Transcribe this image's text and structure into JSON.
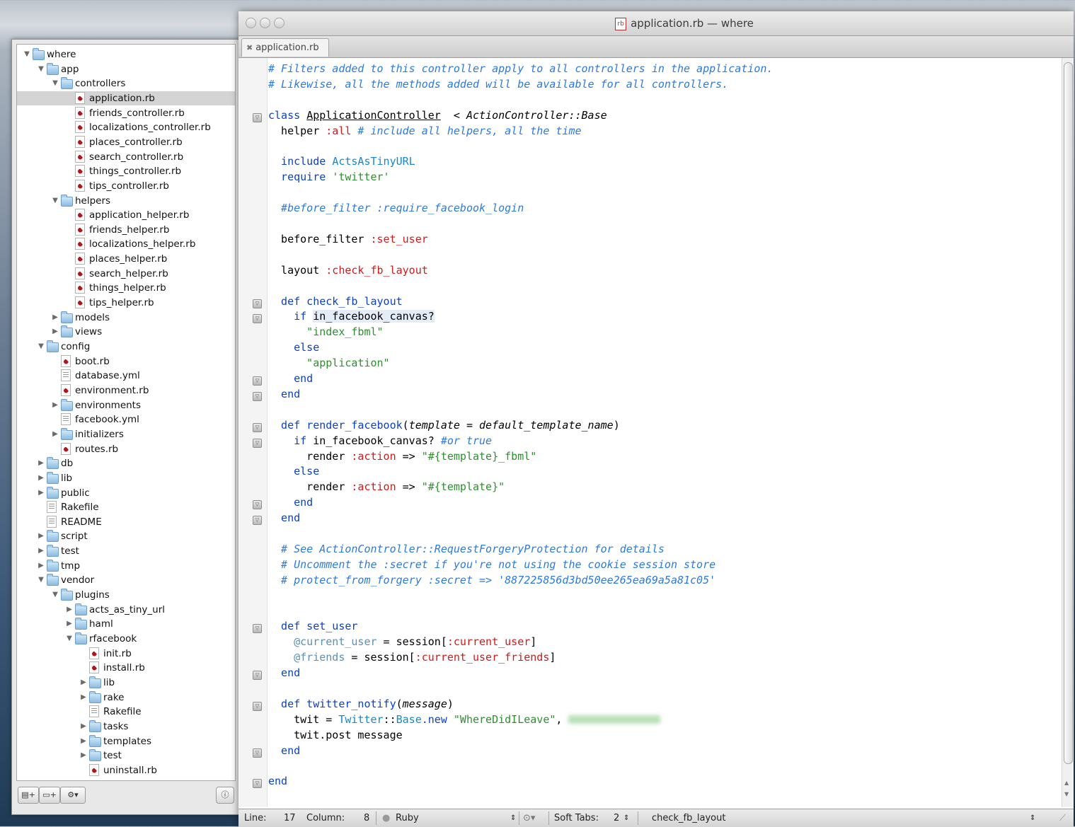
{
  "window": {
    "title": "application.rb — where",
    "doc_icon": "rb",
    "tab_label": "application.rb"
  },
  "tree": [
    {
      "depth": 0,
      "type": "folder",
      "open": true,
      "label": "where"
    },
    {
      "depth": 1,
      "type": "folder",
      "open": true,
      "label": "app"
    },
    {
      "depth": 2,
      "type": "folder",
      "open": true,
      "label": "controllers"
    },
    {
      "depth": 3,
      "type": "rb",
      "label": "application.rb",
      "selected": true
    },
    {
      "depth": 3,
      "type": "rb",
      "label": "friends_controller.rb"
    },
    {
      "depth": 3,
      "type": "rb",
      "label": "localizations_controller.rb"
    },
    {
      "depth": 3,
      "type": "rb",
      "label": "places_controller.rb"
    },
    {
      "depth": 3,
      "type": "rb",
      "label": "search_controller.rb"
    },
    {
      "depth": 3,
      "type": "rb",
      "label": "things_controller.rb"
    },
    {
      "depth": 3,
      "type": "rb",
      "label": "tips_controller.rb"
    },
    {
      "depth": 2,
      "type": "folder",
      "open": true,
      "label": "helpers"
    },
    {
      "depth": 3,
      "type": "rb",
      "label": "application_helper.rb"
    },
    {
      "depth": 3,
      "type": "rb",
      "label": "friends_helper.rb"
    },
    {
      "depth": 3,
      "type": "rb",
      "label": "localizations_helper.rb"
    },
    {
      "depth": 3,
      "type": "rb",
      "label": "places_helper.rb"
    },
    {
      "depth": 3,
      "type": "rb",
      "label": "search_helper.rb"
    },
    {
      "depth": 3,
      "type": "rb",
      "label": "things_helper.rb"
    },
    {
      "depth": 3,
      "type": "rb",
      "label": "tips_helper.rb"
    },
    {
      "depth": 2,
      "type": "folder",
      "open": false,
      "label": "models"
    },
    {
      "depth": 2,
      "type": "folder",
      "open": false,
      "label": "views"
    },
    {
      "depth": 1,
      "type": "folder",
      "open": true,
      "label": "config"
    },
    {
      "depth": 2,
      "type": "rb",
      "label": "boot.rb"
    },
    {
      "depth": 2,
      "type": "txt",
      "label": "database.yml"
    },
    {
      "depth": 2,
      "type": "rb",
      "label": "environment.rb"
    },
    {
      "depth": 2,
      "type": "folder",
      "open": false,
      "label": "environments"
    },
    {
      "depth": 2,
      "type": "txt",
      "label": "facebook.yml"
    },
    {
      "depth": 2,
      "type": "folder",
      "open": false,
      "label": "initializers"
    },
    {
      "depth": 2,
      "type": "rb",
      "label": "routes.rb"
    },
    {
      "depth": 1,
      "type": "folder",
      "open": false,
      "label": "db"
    },
    {
      "depth": 1,
      "type": "folder",
      "open": false,
      "label": "lib"
    },
    {
      "depth": 1,
      "type": "folder",
      "open": false,
      "label": "public"
    },
    {
      "depth": 1,
      "type": "txt",
      "label": "Rakefile"
    },
    {
      "depth": 1,
      "type": "txt",
      "label": "README"
    },
    {
      "depth": 1,
      "type": "folder",
      "open": false,
      "label": "script"
    },
    {
      "depth": 1,
      "type": "folder",
      "open": false,
      "label": "test"
    },
    {
      "depth": 1,
      "type": "folder",
      "open": false,
      "label": "tmp"
    },
    {
      "depth": 1,
      "type": "folder",
      "open": true,
      "label": "vendor"
    },
    {
      "depth": 2,
      "type": "folder",
      "open": true,
      "label": "plugins"
    },
    {
      "depth": 3,
      "type": "folder",
      "open": false,
      "label": "acts_as_tiny_url"
    },
    {
      "depth": 3,
      "type": "folder",
      "open": false,
      "label": "haml"
    },
    {
      "depth": 3,
      "type": "folder",
      "open": true,
      "label": "rfacebook"
    },
    {
      "depth": 4,
      "type": "rb",
      "label": "init.rb"
    },
    {
      "depth": 4,
      "type": "rb",
      "label": "install.rb"
    },
    {
      "depth": 4,
      "type": "folder",
      "open": false,
      "label": "lib"
    },
    {
      "depth": 4,
      "type": "folder",
      "open": false,
      "label": "rake"
    },
    {
      "depth": 4,
      "type": "txt",
      "label": "Rakefile"
    },
    {
      "depth": 4,
      "type": "folder",
      "open": false,
      "label": "tasks"
    },
    {
      "depth": 4,
      "type": "folder",
      "open": false,
      "label": "templates"
    },
    {
      "depth": 4,
      "type": "folder",
      "open": false,
      "label": "test"
    },
    {
      "depth": 4,
      "type": "rb",
      "label": "uninstall.rb"
    }
  ],
  "drawer_buttons": {
    "new_file_icon": "new-file-icon",
    "new_folder_icon": "new-folder-icon",
    "action_icon": "gear-icon",
    "info_icon": "info-icon"
  },
  "code_lines": [
    [
      [
        "cm",
        "# Filters added to this controller apply to all controllers in the application."
      ]
    ],
    [
      [
        "cm",
        "# Likewise, all the methods added will be available for all controllers."
      ]
    ],
    [],
    [
      [
        "kw",
        "class "
      ],
      [
        "ul",
        "ApplicationController"
      ],
      [
        "",
        "  < "
      ],
      [
        "it",
        "ActionController::Base"
      ]
    ],
    [
      [
        "",
        "  helper "
      ],
      [
        "sym",
        ":all"
      ],
      [
        "cm",
        " # include all helpers, all the time"
      ]
    ],
    [],
    [
      [
        "kw",
        "  include "
      ],
      [
        "cls",
        "ActsAsTinyURL"
      ]
    ],
    [
      [
        "kw",
        "  require "
      ],
      [
        "str",
        "'twitter'"
      ]
    ],
    [],
    [
      [
        "cm",
        "  #before_filter :require_facebook_login"
      ]
    ],
    [],
    [
      [
        "",
        "  before_filter "
      ],
      [
        "sym",
        ":set_user"
      ]
    ],
    [],
    [
      [
        "",
        "  layout "
      ],
      [
        "sym",
        ":check_fb_layout"
      ]
    ],
    [],
    [
      [
        "kw",
        "  def check_fb_layout"
      ]
    ],
    [
      [
        "kw",
        "    if "
      ],
      [
        "hl",
        "in_facebook_canvas?"
      ]
    ],
    [
      [
        "str",
        "      \"index_fbml\""
      ]
    ],
    [
      [
        "kw",
        "    else"
      ]
    ],
    [
      [
        "str",
        "      \"application\""
      ]
    ],
    [
      [
        "kw",
        "    end"
      ]
    ],
    [
      [
        "kw",
        "  end"
      ]
    ],
    [],
    [
      [
        "kw",
        "  def render_facebook"
      ],
      [
        "",
        "("
      ],
      [
        "it",
        "template"
      ],
      [
        "",
        " = "
      ],
      [
        "it",
        "default_template_name"
      ],
      [
        "",
        ")"
      ]
    ],
    [
      [
        "kw",
        "    if "
      ],
      [
        "",
        "in_facebook_canvas? "
      ],
      [
        "cm",
        "#or true"
      ]
    ],
    [
      [
        "",
        "      render "
      ],
      [
        "sym",
        ":action"
      ],
      [
        "",
        " => "
      ],
      [
        "str",
        "\"#{template}_fbml\""
      ]
    ],
    [
      [
        "kw",
        "    else"
      ]
    ],
    [
      [
        "",
        "      render "
      ],
      [
        "sym",
        ":action"
      ],
      [
        "",
        " => "
      ],
      [
        "str",
        "\"#{template}\""
      ]
    ],
    [
      [
        "kw",
        "    end"
      ]
    ],
    [
      [
        "kw",
        "  end"
      ]
    ],
    [],
    [
      [
        "cm",
        "  # See ActionController::RequestForgeryProtection for details"
      ]
    ],
    [
      [
        "cm",
        "  # Uncomment the :secret if you're not using the cookie session store"
      ]
    ],
    [
      [
        "cm",
        "  # protect_from_forgery :secret => '887225856d3bd50ee265ea69a5a81c05'"
      ]
    ],
    [],
    [],
    [
      [
        "kw",
        "  def set_user"
      ]
    ],
    [
      [
        "var",
        "    @current_user"
      ],
      [
        "",
        " = session["
      ],
      [
        "sym",
        ":current_user"
      ],
      [
        "",
        "]"
      ]
    ],
    [
      [
        "var",
        "    @friends"
      ],
      [
        "",
        " = session["
      ],
      [
        "sym",
        ":current_user_friends"
      ],
      [
        "",
        "]"
      ]
    ],
    [
      [
        "kw",
        "  end"
      ]
    ],
    [],
    [
      [
        "kw",
        "  def twitter_notify"
      ],
      [
        "",
        "("
      ],
      [
        "it",
        "message"
      ],
      [
        "",
        ")"
      ]
    ],
    [
      [
        "",
        "    twit = "
      ],
      [
        "cls",
        "Twitter"
      ],
      [
        "",
        "::"
      ],
      [
        "cls",
        "Base"
      ],
      [
        "kw",
        ".new "
      ],
      [
        "str",
        "\"WhereDidILeave\""
      ],
      [
        "",
        ", "
      ],
      [
        "blur",
        ""
      ]
    ],
    [
      [
        "",
        "    twit.post message"
      ]
    ],
    [
      [
        "kw",
        "  end"
      ]
    ],
    [],
    [
      [
        "kw",
        "end"
      ]
    ]
  ],
  "fold_marks": [
    3,
    15,
    16,
    20,
    21,
    23,
    24,
    28,
    29,
    36,
    39,
    41,
    44,
    46
  ],
  "status": {
    "line_label": "Line:",
    "line_value": "17",
    "column_label": "Column:",
    "column_value": "8",
    "language": "Ruby",
    "tabs_label": "Soft Tabs:",
    "tabs_value": "2",
    "symbol": "check_fb_layout"
  }
}
